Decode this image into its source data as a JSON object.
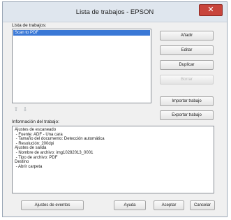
{
  "window": {
    "title": "Lista de trabajos - EPSON",
    "close_symbol": "✕"
  },
  "jobs": {
    "label": "Lista de trabajos:",
    "items": [
      "Scan to PDF"
    ]
  },
  "buttons": {
    "add": "Añadir",
    "edit": "Editar",
    "duplicate": "Duplicar",
    "delete": "Borrar",
    "import": "Importar trabajo",
    "export": "Exportar trabajo",
    "event_settings": "Ajustes de eventos",
    "help": "Ayuda",
    "accept": "Aceptar",
    "cancel": "Cancelar"
  },
  "arrows": {
    "up": "⇧",
    "down": "⇩"
  },
  "info": {
    "label": "Información del trabajo:",
    "lines": [
      "Ajustes de escaneado",
      " - Fuente: ADF - Una cara",
      " - Tamaño del documento: Detección automática",
      " - Resolución: 200dpi",
      "Ajustes de salida",
      " - Nombre de archivo: img10282013_0001",
      " - Tipo de archivo: PDF",
      "Destino",
      " - Abrir carpeta"
    ]
  },
  "colors": {
    "selection": "#3a78d6",
    "close": "#c8453c",
    "titlebar": "#dfe6ee"
  },
  "icons": {
    "up": "arrow-up-icon",
    "down": "arrow-down-icon",
    "close": "close-icon"
  }
}
